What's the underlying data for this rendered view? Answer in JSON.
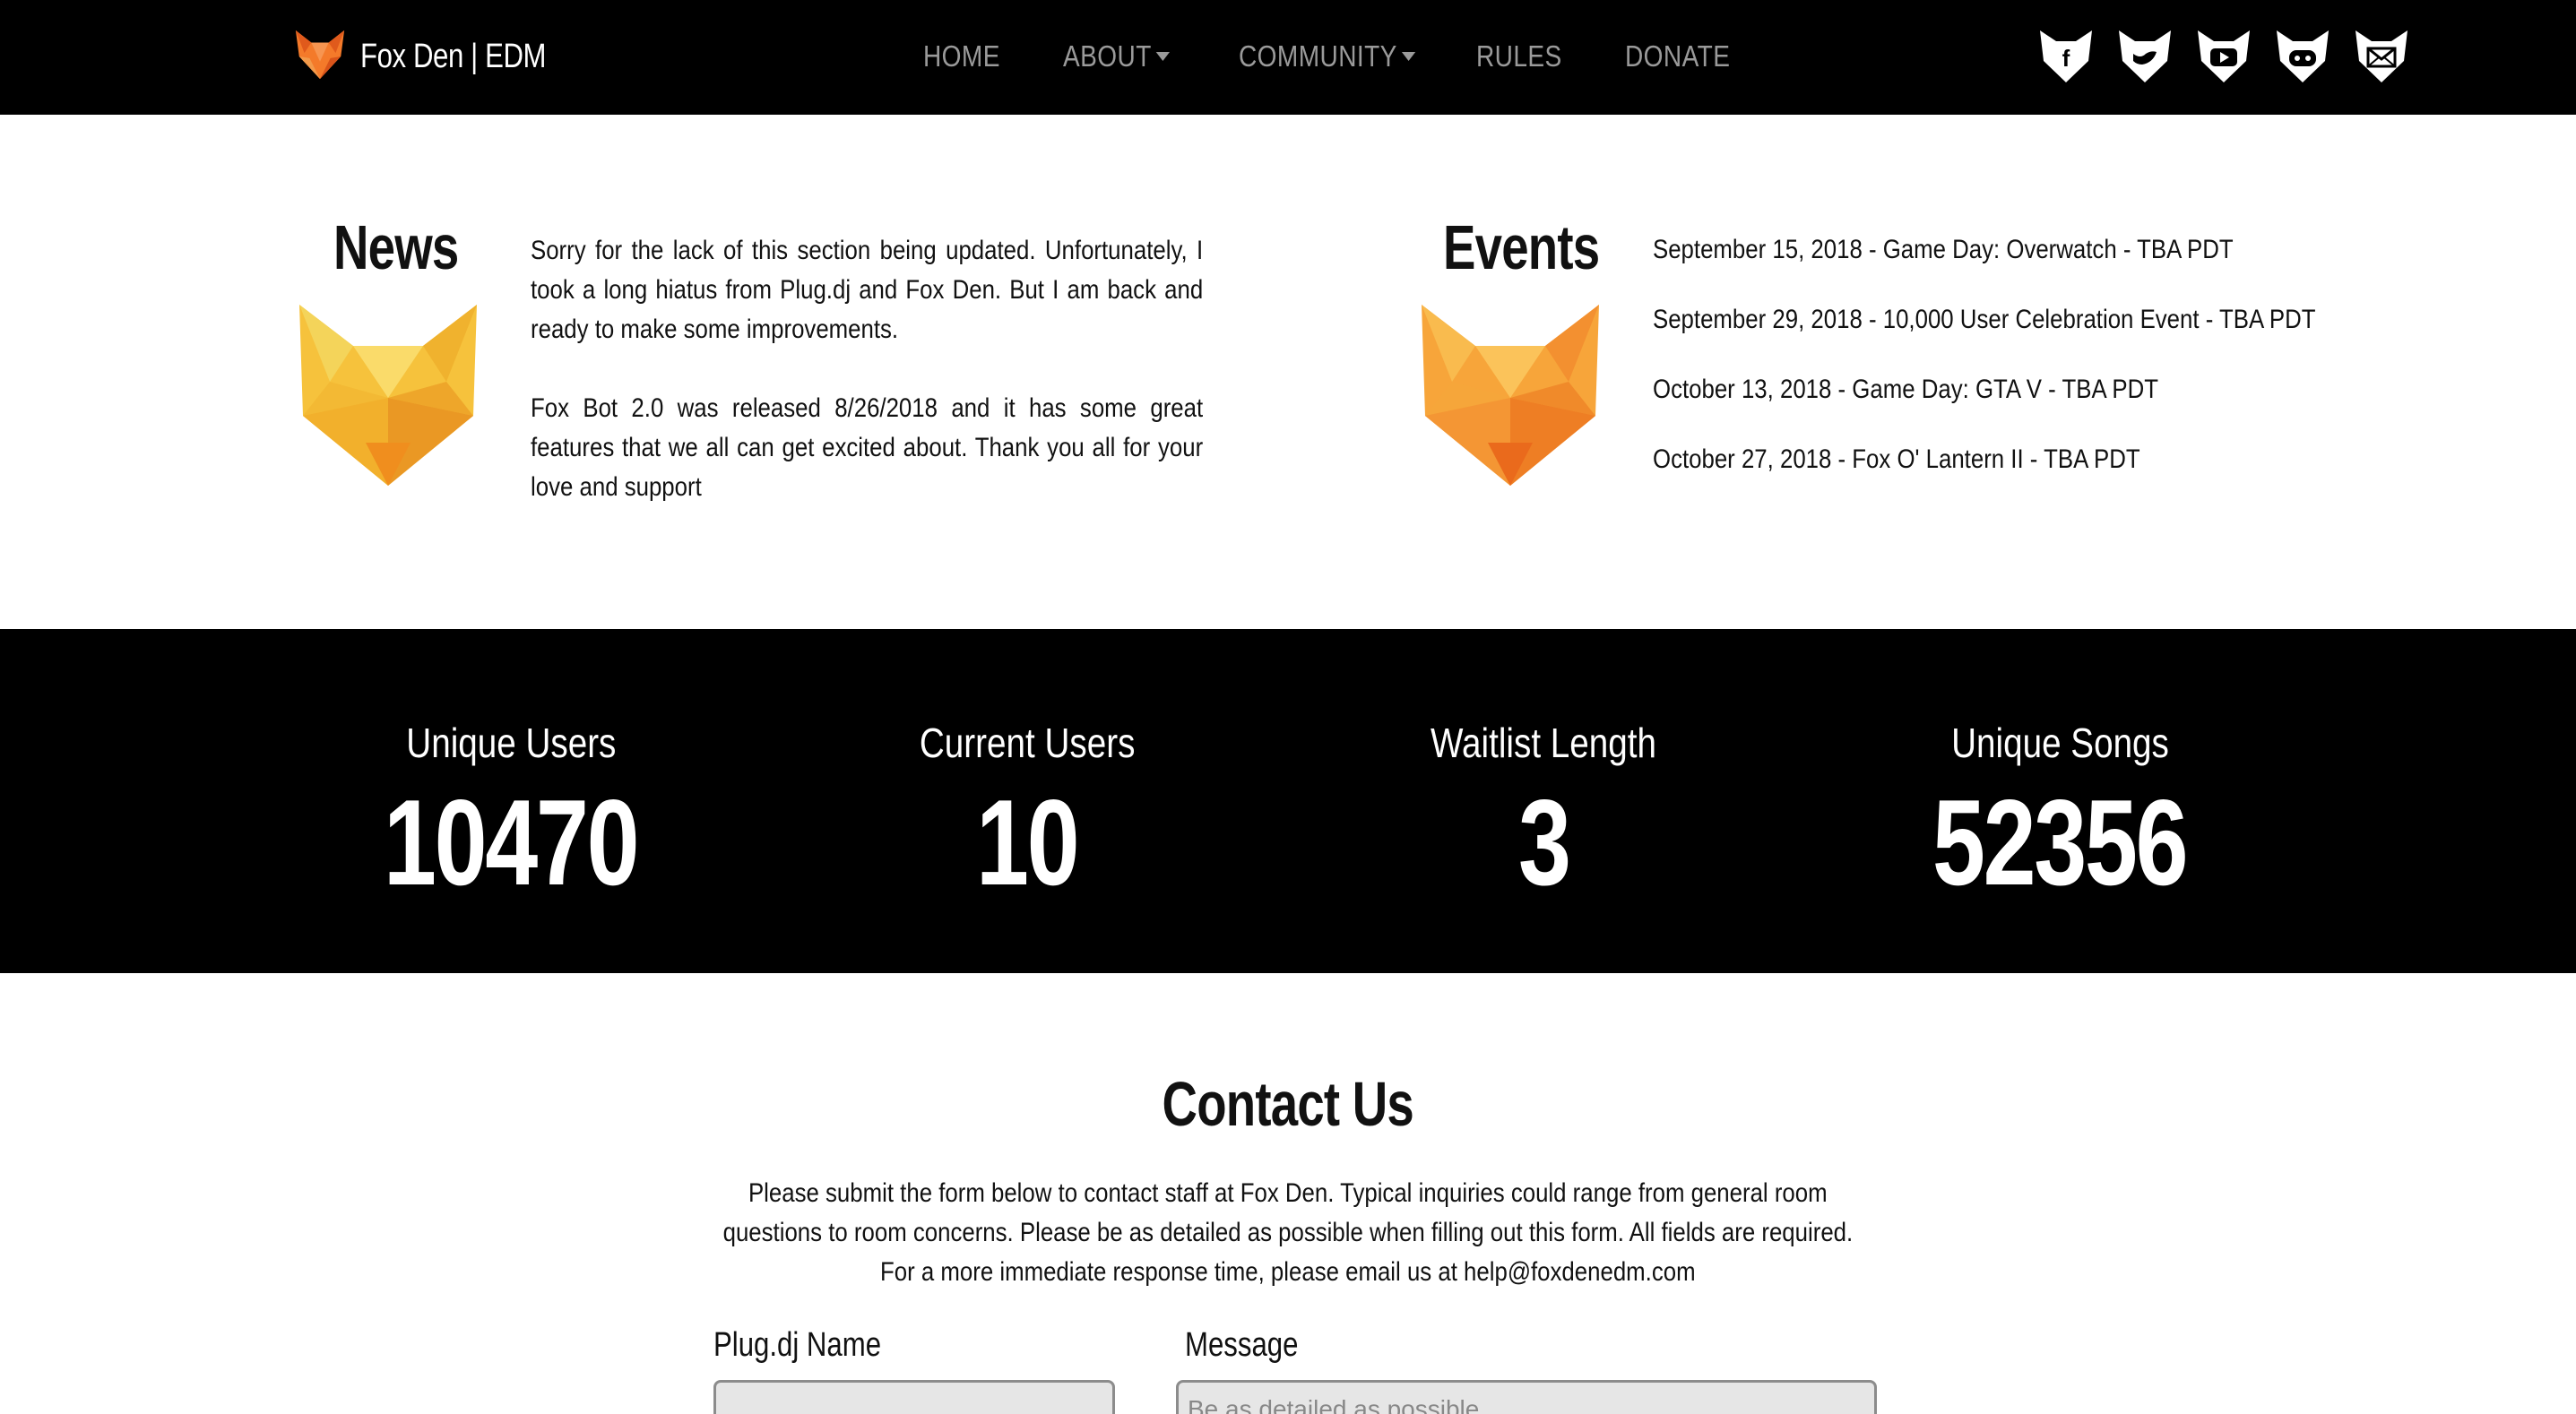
{
  "brand": {
    "name": "Fox Den | EDM"
  },
  "nav": {
    "items": [
      {
        "label": "HOME",
        "dropdown": false
      },
      {
        "label": "ABOUT",
        "dropdown": true
      },
      {
        "label": "COMMUNITY",
        "dropdown": true
      },
      {
        "label": "RULES",
        "dropdown": false
      },
      {
        "label": "DONATE",
        "dropdown": false
      }
    ],
    "social_icons": [
      "facebook-fox-icon",
      "twitter-fox-icon",
      "youtube-fox-icon",
      "discord-fox-icon",
      "email-fox-icon"
    ]
  },
  "news": {
    "title": "News",
    "paragraphs": [
      "Sorry for the lack of this section being updated. Unfortunately, I took a long hiatus from Plug.dj and Fox Den. But I am back and ready to make some improvements.",
      "Fox Bot 2.0 was released 8/26/2018 and it has some great features that we all can get excited about. Thank you all for your love and support"
    ]
  },
  "events": {
    "title": "Events",
    "items": [
      "September 15, 2018 - Game Day: Overwatch - TBA PDT",
      "September 29, 2018 - 10,000 User Celebration Event - TBA PDT",
      "October 13, 2018 - Game Day: GTA V - TBA PDT",
      "October 27, 2018 - Fox O' Lantern II - TBA PDT"
    ]
  },
  "stats": [
    {
      "label": "Unique Users",
      "value": "10470"
    },
    {
      "label": "Current Users",
      "value": "10"
    },
    {
      "label": "Waitlist Length",
      "value": "3"
    },
    {
      "label": "Unique Songs",
      "value": "52356"
    }
  ],
  "contact": {
    "title": "Contact Us",
    "description_lines": [
      "Please submit the form below to contact staff at Fox Den. Typical inquiries could range from general room",
      "questions to room concerns. Please be as detailed as possible when filling out this form. All fields are required.",
      "For a more immediate response time, please email us at help@foxdenedm.com"
    ],
    "name_label": "Plug.dj Name",
    "message_label": "Message",
    "message_placeholder": "Be as detailed as possible"
  },
  "colors": {
    "navbar_bg": "#000000",
    "nav_text": "#9a9a9a",
    "stats_bg": "#000000",
    "fox_orange": "#f47a2a",
    "news_fox_yellow": "#f6c23c"
  }
}
